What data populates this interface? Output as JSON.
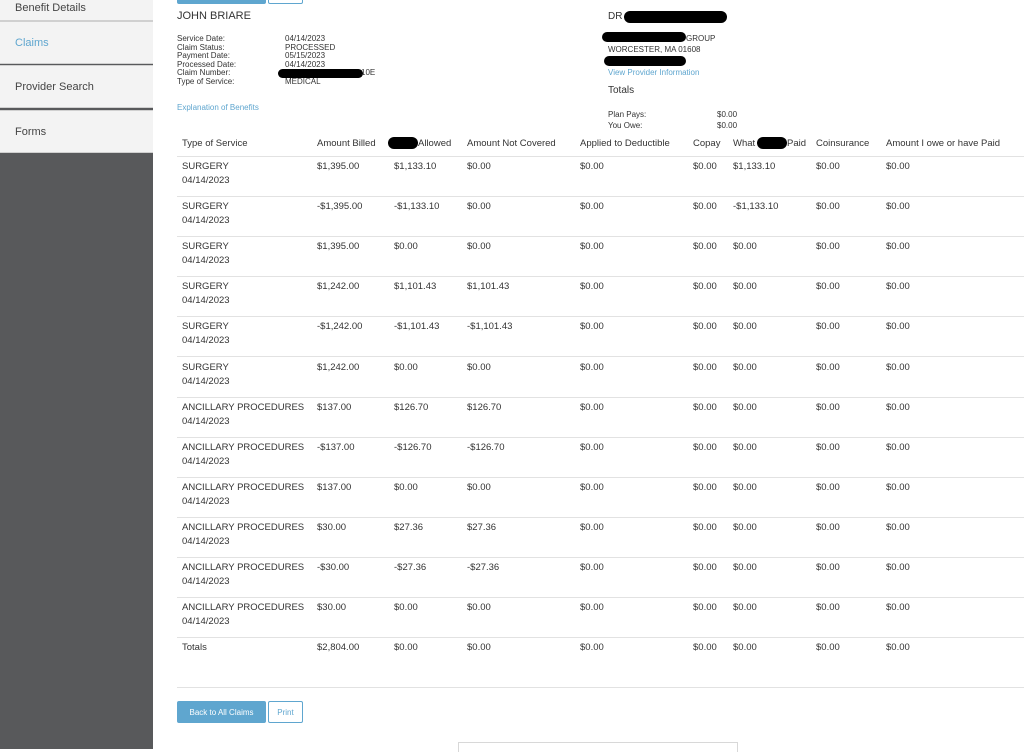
{
  "sidebar": {
    "items": [
      {
        "label": "Benefit Details"
      },
      {
        "label": "Claims"
      },
      {
        "label": "Provider Search"
      },
      {
        "label": "Forms"
      }
    ]
  },
  "member": {
    "name": "JOHN BRIARE"
  },
  "claim": {
    "service_date_label": "Service Date:",
    "service_date": "04/14/2023",
    "status_label": "Claim Status:",
    "status": "PROCESSED",
    "payment_date_label": "Payment Date:",
    "payment_date": "05/15/2023",
    "processed_date_label": "Processed Date:",
    "processed_date": "04/14/2023",
    "number_label": "Claim Number:",
    "number_suffix": "10E",
    "type_label": "Type of Service:",
    "type": "MEDICAL",
    "eob_link": "Explanation of Benefits"
  },
  "provider": {
    "name_prefix": "DR",
    "group_suffix": "GROUP",
    "address": "WORCESTER, MA 01608",
    "info_link": "View Provider Information"
  },
  "totals": {
    "title": "Totals",
    "plan_pays_label": "Plan Pays:",
    "plan_pays": "$0.00",
    "you_owe_label": "You Owe:",
    "you_owe": "$0.00"
  },
  "table": {
    "headers": {
      "type": "Type of Service",
      "billed": "Amount Billed",
      "allowed_suffix": "Allowed",
      "not_covered": "Amount Not Covered",
      "deductible": "Applied to Deductible",
      "copay": "Copay",
      "paid_prefix": "What",
      "paid_suffix": "Paid",
      "coinsurance": "Coinsurance",
      "owe": "Amount I owe or have Paid"
    },
    "rows": [
      {
        "type": "SURGERY",
        "date": "04/14/2023",
        "billed": "$1,395.00",
        "allowed": "$1,133.10",
        "not_covered": "$0.00",
        "deductible": "$0.00",
        "copay": "$0.00",
        "paid": "$1,133.10",
        "coinsurance": "$0.00",
        "owe": "$0.00"
      },
      {
        "type": "SURGERY",
        "date": "04/14/2023",
        "billed": "-$1,395.00",
        "allowed": "-$1,133.10",
        "not_covered": "$0.00",
        "deductible": "$0.00",
        "copay": "$0.00",
        "paid": "-$1,133.10",
        "coinsurance": "$0.00",
        "owe": "$0.00"
      },
      {
        "type": "SURGERY",
        "date": "04/14/2023",
        "billed": "$1,395.00",
        "allowed": "$0.00",
        "not_covered": "$0.00",
        "deductible": "$0.00",
        "copay": "$0.00",
        "paid": "$0.00",
        "coinsurance": "$0.00",
        "owe": "$0.00"
      },
      {
        "type": "SURGERY",
        "date": "04/14/2023",
        "billed": "$1,242.00",
        "allowed": "$1,101.43",
        "not_covered": "$1,101.43",
        "deductible": "$0.00",
        "copay": "$0.00",
        "paid": "$0.00",
        "coinsurance": "$0.00",
        "owe": "$0.00"
      },
      {
        "type": "SURGERY",
        "date": "04/14/2023",
        "billed": "-$1,242.00",
        "allowed": "-$1,101.43",
        "not_covered": "-$1,101.43",
        "deductible": "$0.00",
        "copay": "$0.00",
        "paid": "$0.00",
        "coinsurance": "$0.00",
        "owe": "$0.00"
      },
      {
        "type": "SURGERY",
        "date": "04/14/2023",
        "billed": "$1,242.00",
        "allowed": "$0.00",
        "not_covered": "$0.00",
        "deductible": "$0.00",
        "copay": "$0.00",
        "paid": "$0.00",
        "coinsurance": "$0.00",
        "owe": "$0.00"
      },
      {
        "type": "ANCILLARY PROCEDURES",
        "date": "04/14/2023",
        "billed": "$137.00",
        "allowed": "$126.70",
        "not_covered": "$126.70",
        "deductible": "$0.00",
        "copay": "$0.00",
        "paid": "$0.00",
        "coinsurance": "$0.00",
        "owe": "$0.00"
      },
      {
        "type": "ANCILLARY PROCEDURES",
        "date": "04/14/2023",
        "billed": "-$137.00",
        "allowed": "-$126.70",
        "not_covered": "-$126.70",
        "deductible": "$0.00",
        "copay": "$0.00",
        "paid": "$0.00",
        "coinsurance": "$0.00",
        "owe": "$0.00"
      },
      {
        "type": "ANCILLARY PROCEDURES",
        "date": "04/14/2023",
        "billed": "$137.00",
        "allowed": "$0.00",
        "not_covered": "$0.00",
        "deductible": "$0.00",
        "copay": "$0.00",
        "paid": "$0.00",
        "coinsurance": "$0.00",
        "owe": "$0.00"
      },
      {
        "type": "ANCILLARY PROCEDURES",
        "date": "04/14/2023",
        "billed": "$30.00",
        "allowed": "$27.36",
        "not_covered": "$27.36",
        "deductible": "$0.00",
        "copay": "$0.00",
        "paid": "$0.00",
        "coinsurance": "$0.00",
        "owe": "$0.00"
      },
      {
        "type": "ANCILLARY PROCEDURES",
        "date": "04/14/2023",
        "billed": "-$30.00",
        "allowed": "-$27.36",
        "not_covered": "-$27.36",
        "deductible": "$0.00",
        "copay": "$0.00",
        "paid": "$0.00",
        "coinsurance": "$0.00",
        "owe": "$0.00"
      },
      {
        "type": "ANCILLARY PROCEDURES",
        "date": "04/14/2023",
        "billed": "$30.00",
        "allowed": "$0.00",
        "not_covered": "$0.00",
        "deductible": "$0.00",
        "copay": "$0.00",
        "paid": "$0.00",
        "coinsurance": "$0.00",
        "owe": "$0.00"
      }
    ],
    "totals_row": {
      "type": "Totals",
      "billed": "$2,804.00",
      "allowed": "$0.00",
      "not_covered": "$0.00",
      "deductible": "$0.00",
      "copay": "$0.00",
      "paid": "$0.00",
      "coinsurance": "$0.00",
      "owe": "$0.00"
    }
  },
  "actions": {
    "back_label": "Back to All Claims",
    "print_label": "Print"
  }
}
